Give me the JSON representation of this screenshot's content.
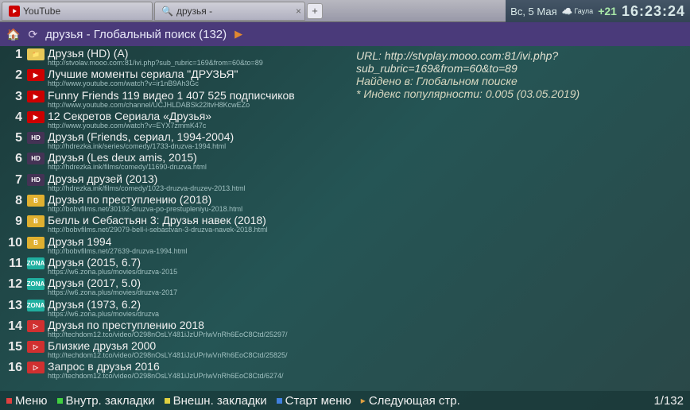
{
  "tabs": [
    {
      "icon": "youtube",
      "label": "YouTube"
    },
    {
      "icon": "doc",
      "label": "друзья -"
    }
  ],
  "clock": {
    "date": "Вс, 5 Мая",
    "weather_label": "Гаула",
    "weather_temp": "+21",
    "time": "16:23:24"
  },
  "header": {
    "title": "друзья - Глобальный поиск (132)"
  },
  "details": {
    "url_label": "URL: http://stvplay.mooo.com:81/ivi.php?sub_rubric=169&from=60&to=89",
    "found_in": "Найдено в: Глобальном поиске",
    "index": "* Индекс популярности: 0.005 (03.05.2019)"
  },
  "footer": {
    "menu": "Меню",
    "inner": "Внутр. закладки",
    "outer": "Внешн. закладки",
    "start": "Старт меню",
    "next": "Следующая стр.",
    "page": "1/132"
  },
  "list": [
    {
      "num": "1",
      "icon": "folder",
      "title": "Друзья (HD) (A)",
      "url": "http://stvolav.mooo.com:81/ivi.php?sub_rubric=169&from=60&to=89"
    },
    {
      "num": "2",
      "icon": "youtube",
      "title": "Лучшие моменты сериала \"ДРУЗЬЯ\"",
      "url": "http://www.youtube.com/watch?v=ir1nB9Ah3Gc"
    },
    {
      "num": "3",
      "icon": "youtube",
      "title": "Funny Friends 119 видео 1 407 525 подписчиков",
      "url": "http://www.youtube.com/channel/UCJHLDABSk22ltvH8KcwEZo"
    },
    {
      "num": "4",
      "icon": "youtube",
      "title": "12 Секретов Сериала «Друзья»",
      "url": "http://www.youtube.com/watch?v=EYX7zmmK47c"
    },
    {
      "num": "5",
      "icon": "hdrezka",
      "title": "Друзья (Friends, сериал, 1994-2004)",
      "url": "http://hdrezka.ink/series/comedy/1733-druzva-1994.html"
    },
    {
      "num": "6",
      "icon": "hdrezka",
      "title": "Друзья (Les deux amis, 2015)",
      "url": "http://hdrezka.ink/films/comedy/11690-druzva.html"
    },
    {
      "num": "7",
      "icon": "hdrezka",
      "title": "Друзья друзей (2013)",
      "url": "http://hdrezka.ink/films/comedy/1023-druzva-druzev-2013.html"
    },
    {
      "num": "8",
      "icon": "bobfilms",
      "title": "Друзья по преступлению (2018)",
      "url": "http://bobvfilms.net/30192-druzva-po-prestupleniyu-2018.html"
    },
    {
      "num": "9",
      "icon": "bobfilms",
      "title": "Белль и Себастьян 3: Друзья навек (2018)",
      "url": "http://bobvfilms.net/29079-bell-i-sebastvan-3-druzva-navek-2018.html"
    },
    {
      "num": "10",
      "icon": "bobfilms",
      "title": "Друзья 1994",
      "url": "http://bobvfilms.net/27639-druzva-1994.html"
    },
    {
      "num": "11",
      "icon": "zona",
      "title": "Друзья (2015, 6.7)",
      "url": "https://w6.zona.plus/movies/druzva-2015"
    },
    {
      "num": "12",
      "icon": "zona",
      "title": "Друзья (2017, 5.0)",
      "url": "https://w6.zona.plus/movies/druzva-2017"
    },
    {
      "num": "13",
      "icon": "zona",
      "title": "Друзья (1973, 6.2)",
      "url": "https://w6.zona.plus/movies/druzva"
    },
    {
      "num": "14",
      "icon": "tech",
      "title": "Друзья по преступлению 2018",
      "url": "http://techdom12.tco/video/O298nOsLY481iJzUPrIwVnRh6EoC8Ctd/25297/"
    },
    {
      "num": "15",
      "icon": "tech",
      "title": "Близкие друзья 2000",
      "url": "http://techdom12.tco/video/O298nOsLY481iJzUPrIwVnRh6EoC8Ctd/25825/"
    },
    {
      "num": "16",
      "icon": "tech",
      "title": "Запрос в друзья 2016",
      "url": "http://techdom12.tco/video/O298nOsLY481iJzUPrIwVnRh6EoC8Ctd/6274/"
    }
  ]
}
